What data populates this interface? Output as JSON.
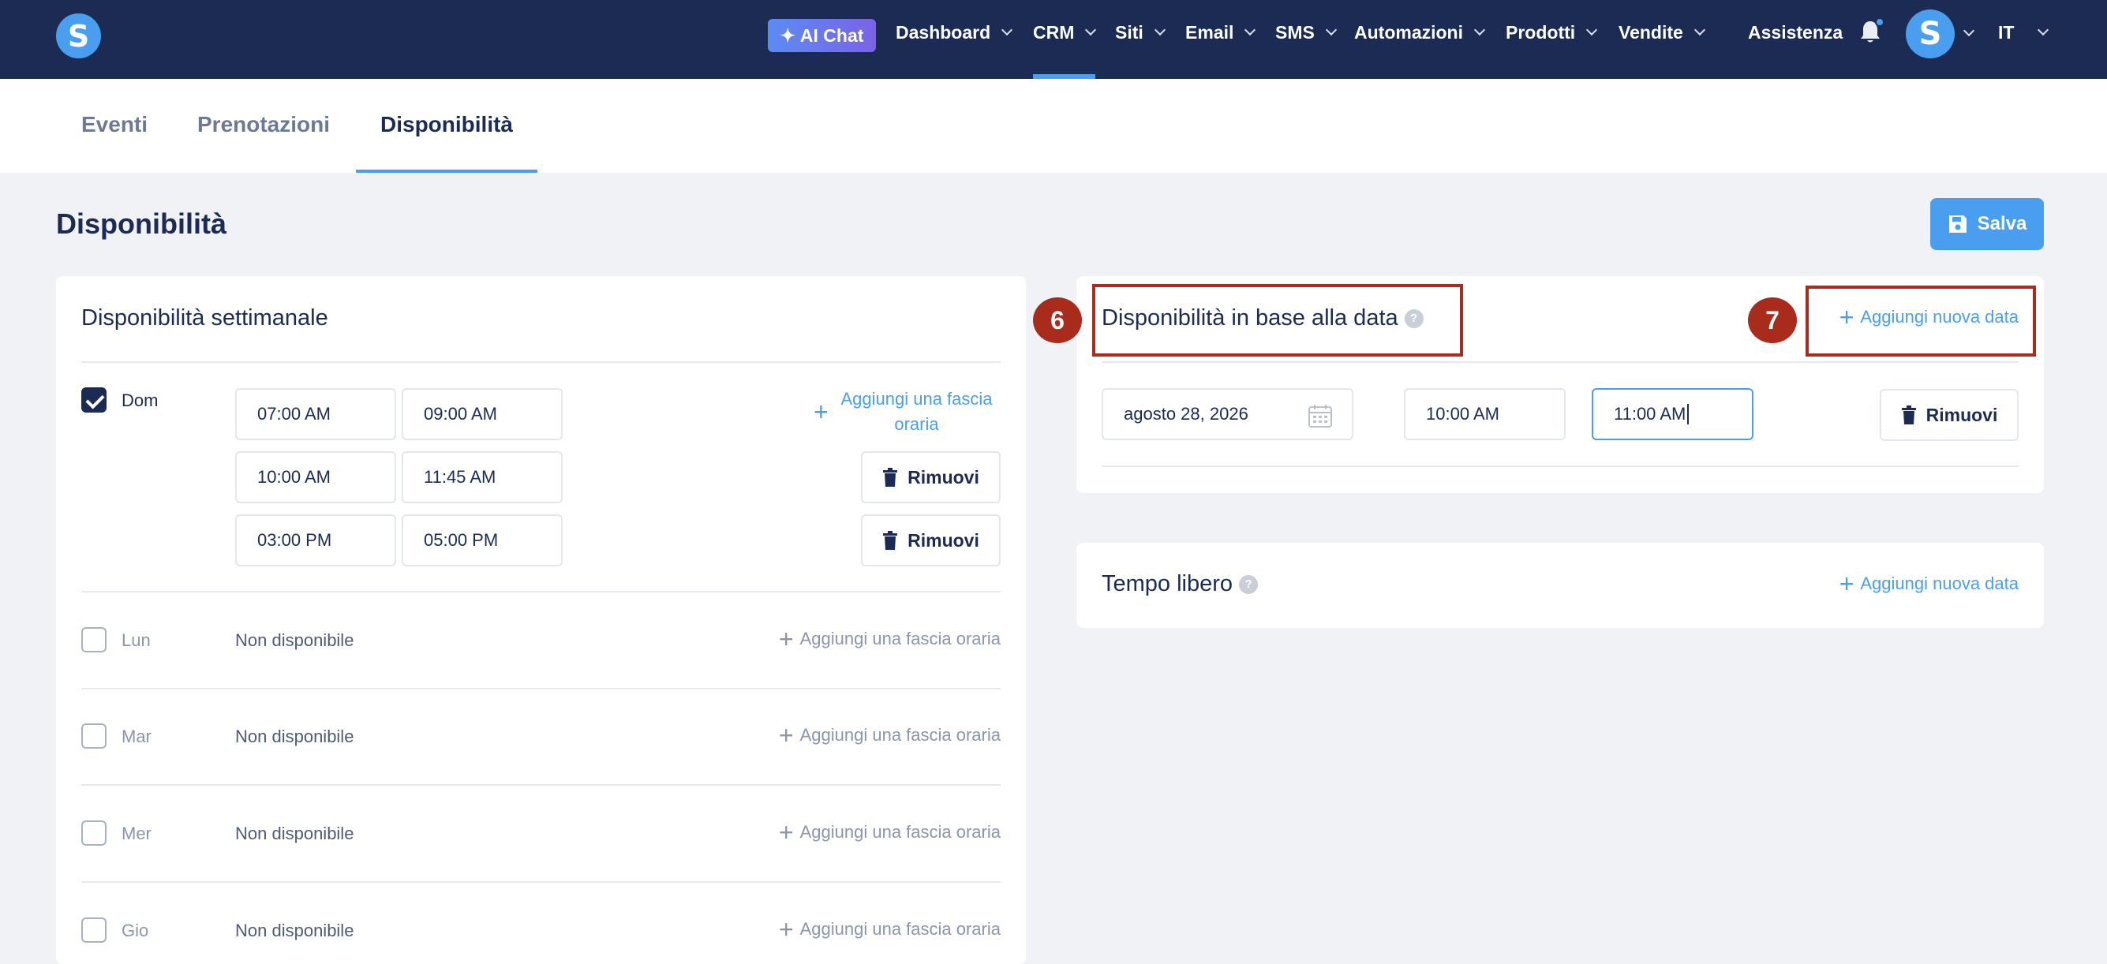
{
  "nav": {
    "ai_chat": "AI Chat",
    "items": [
      "Dashboard",
      "CRM",
      "Siti",
      "Email",
      "SMS",
      "Automazioni",
      "Prodotti",
      "Vendite"
    ],
    "assistenza": "Assistenza",
    "language": "IT",
    "logo_letter": "S",
    "avatar_letter": "S"
  },
  "tabs": [
    "Eventi",
    "Prenotazioni",
    "Disponibilità"
  ],
  "page": {
    "title": "Disponibilità",
    "save_label": "Salva"
  },
  "weekly": {
    "title": "Disponibilità settimanale",
    "add_slot": "Aggiungi una fascia oraria",
    "add_slot_line1": "Aggiungi una fascia",
    "add_slot_line2": "oraria",
    "remove_label": "Rimuovi",
    "unavailable": "Non disponibile",
    "days": [
      {
        "name": "Dom",
        "checked": true,
        "slots": [
          [
            "07:00 AM",
            "09:00 AM"
          ],
          [
            "10:00 AM",
            "11:45 AM"
          ],
          [
            "03:00 PM",
            "05:00 PM"
          ]
        ]
      },
      {
        "name": "Lun",
        "checked": false
      },
      {
        "name": "Mar",
        "checked": false
      },
      {
        "name": "Mer",
        "checked": false
      },
      {
        "name": "Gio",
        "checked": false
      }
    ]
  },
  "date_based": {
    "title": "Disponibilità in base alla data",
    "add_label": "Aggiungi nuova data",
    "entry": {
      "date": "agosto 28, 2026",
      "start": "10:00 AM",
      "end": "11:00 AM"
    },
    "remove_label": "Rimuovi"
  },
  "free_time": {
    "title": "Tempo libero",
    "add_label": "Aggiungi nuova data"
  },
  "annotations": {
    "badge_6": "6",
    "badge_7": "7",
    "color": "#a82b1c"
  },
  "colors": {
    "nav_bg": "#1b2b54",
    "accent": "#4a9ef0",
    "page_bg": "#f0f2f6"
  }
}
